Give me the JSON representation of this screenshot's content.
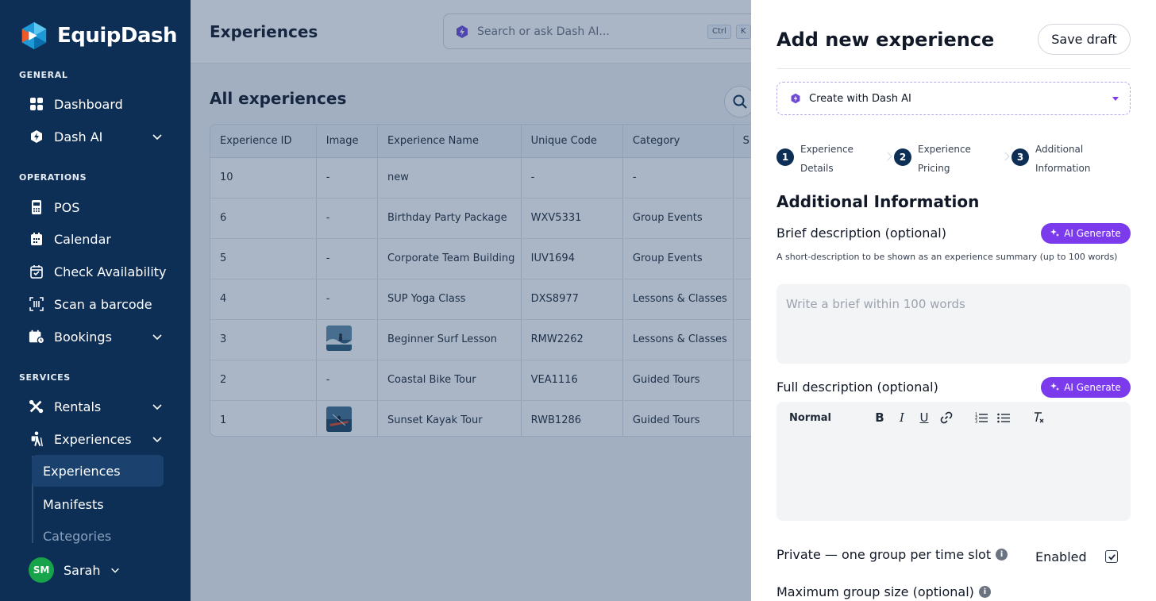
{
  "brand": {
    "name": "EquipDash"
  },
  "sidebar": {
    "sections": {
      "general": "GENERAL",
      "operations": "OPERATIONS",
      "services": "SERVICES"
    },
    "items": {
      "dashboard": "Dashboard",
      "dash_ai": "Dash AI",
      "pos": "POS",
      "calendar": "Calendar",
      "check_availability": "Check Availability",
      "scan_barcode": "Scan a barcode",
      "bookings": "Bookings",
      "rentals": "Rentals",
      "experiences": "Experiences"
    },
    "sub_items": {
      "experiences": "Experiences",
      "manifests": "Manifests",
      "categories": "Categories"
    },
    "user": {
      "initials": "SM",
      "name": "Sarah"
    }
  },
  "header": {
    "title": "Experiences",
    "search_placeholder": "Search or ask Dash AI...",
    "shortcut_keys": [
      "Ctrl",
      "K"
    ]
  },
  "main": {
    "section_title": "All experiences",
    "table": {
      "columns": [
        "Experience ID",
        "Image",
        "Experience Name",
        "Unique Code",
        "Category",
        "S"
      ],
      "rows": [
        {
          "id": "10",
          "image": "-",
          "name": "new",
          "code": "-",
          "category": "-"
        },
        {
          "id": "6",
          "image": "-",
          "name": "Birthday Party Package",
          "code": "WXV5331",
          "category": "Group Events"
        },
        {
          "id": "5",
          "image": "-",
          "name": "Corporate Team Building",
          "code": "IUV1694",
          "category": "Group Events"
        },
        {
          "id": "4",
          "image": "-",
          "name": "SUP Yoga Class",
          "code": "DXS8977",
          "category": "Lessons & Classes"
        },
        {
          "id": "3",
          "image": "thumbnail-surf",
          "name": "Beginner Surf Lesson",
          "code": "RMW2262",
          "category": "Lessons & Classes"
        },
        {
          "id": "2",
          "image": "-",
          "name": "Coastal Bike Tour",
          "code": "VEA1116",
          "category": "Guided Tours"
        },
        {
          "id": "1",
          "image": "thumbnail-kayak",
          "name": "Sunset Kayak Tour",
          "code": "RWB1286",
          "category": "Guided Tours"
        }
      ]
    }
  },
  "drawer": {
    "title": "Add new experience",
    "save_draft": "Save draft",
    "dash_ai_select": "Create with Dash AI",
    "steps": [
      {
        "num": "1",
        "line1": "Experience",
        "line2": "Details"
      },
      {
        "num": "2",
        "line1": "Experience",
        "line2": "Pricing"
      },
      {
        "num": "3",
        "line1": "Additional",
        "line2": "Information"
      }
    ],
    "section_heading": "Additional Information",
    "brief": {
      "label": "Brief description (optional)",
      "ai_button": "AI Generate",
      "helper": "A short-description to be shown as an experience summary (up to 100 words)",
      "placeholder": "Write a brief within 100 words"
    },
    "full": {
      "label": "Full description (optional)",
      "ai_button": "AI Generate",
      "format_select": "Normal"
    },
    "private": {
      "label": "Private — one group per time slot",
      "status": "Enabled",
      "checked": true
    },
    "max_group": {
      "label": "Maximum group size (optional)"
    }
  },
  "colors": {
    "sidebar": "#0e2f55",
    "accent": "#7c3aed",
    "avatar": "#16a34a"
  }
}
